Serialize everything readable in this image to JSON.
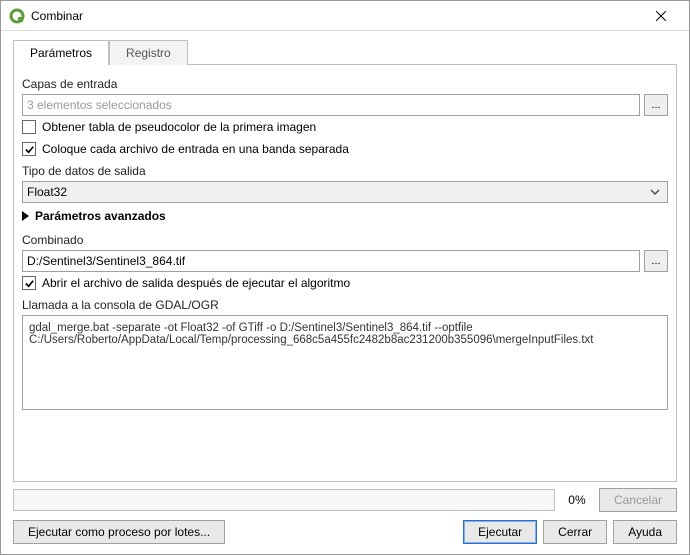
{
  "window": {
    "title": "Combinar",
    "close_icon": "close-icon"
  },
  "tabs": {
    "parametros": "Parámetros",
    "registro": "Registro"
  },
  "form": {
    "input_layers_label": "Capas de entrada",
    "input_layers_value": "3 elementos seleccionados",
    "browse_icon": "...",
    "cb_pseudocolor": {
      "label": "Obtener tabla de pseudocolor de la primera imagen",
      "checked": false
    },
    "cb_separate": {
      "label": "Coloque cada archivo de entrada en una banda separada",
      "checked": true
    },
    "output_type_label": "Tipo de datos de salida",
    "output_type_value": "Float32",
    "advanced_label": "Parámetros avanzados",
    "combined_label": "Combinado",
    "combined_value": "D:/Sentinel3/Sentinel3_864.tif",
    "cb_open_after": {
      "label": "Abrir el archivo de salida después de ejecutar el algoritmo",
      "checked": true
    },
    "console_label": "Llamada a la consola de GDAL/OGR",
    "console_value": "gdal_merge.bat -separate -ot Float32 -of GTiff -o D:/Sentinel3/Sentinel3_864.tif --optfile C:/Users/Roberto/AppData/Local/Temp/processing_668c5a455fc2482b8ac231200b355096\\mergeInputFiles.txt"
  },
  "footer": {
    "progress_pct": "0%",
    "cancel": "Cancelar",
    "batch": "Ejecutar como proceso por lotes...",
    "run": "Ejecutar",
    "close": "Cerrar",
    "help": "Ayuda"
  }
}
